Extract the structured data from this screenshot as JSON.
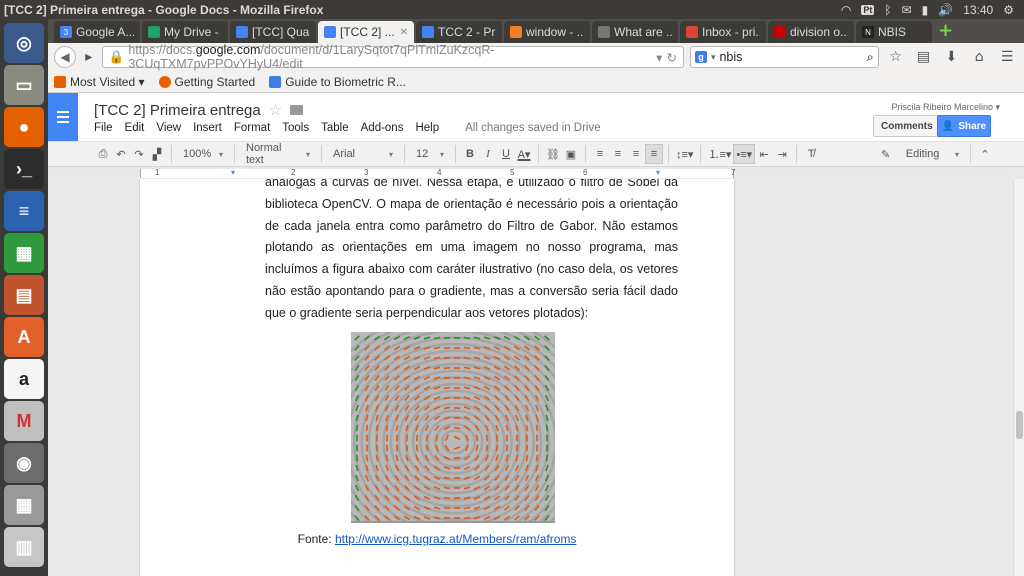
{
  "window": {
    "title": "[TCC 2] Primeira entrega - Google Docs - Mozilla Firefox",
    "tray_pt": "Pt",
    "clock": "13:40"
  },
  "tabs": [
    {
      "label": "Google A...",
      "color": "#4285f4",
      "glyph": "3"
    },
    {
      "label": "My Drive - ...",
      "color": "#1fa463",
      "glyph": ""
    },
    {
      "label": "[TCC] Qua...",
      "color": "#4285f4",
      "glyph": ""
    },
    {
      "label": "[TCC 2] ...",
      "color": "#4285f4",
      "glyph": ""
    },
    {
      "label": "TCC 2 - Pri...",
      "color": "#4285f4",
      "glyph": ""
    },
    {
      "label": "window - ...",
      "color": "#f48024",
      "glyph": ""
    },
    {
      "label": "What are ...",
      "color": "#777777",
      "glyph": ""
    },
    {
      "label": "Inbox - pri...",
      "color": "#db4437",
      "glyph": ""
    },
    {
      "label": "division o...",
      "color": "#cc0000",
      "glyph": ""
    },
    {
      "label": "NBIS",
      "color": "#222222",
      "glyph": "N"
    }
  ],
  "nav": {
    "url_prefix": "https://docs.",
    "url_host": "google.com",
    "url_rest": "/document/d/1LarySqtot7qPlTmiZuKzcqR-3CUqTXM7pvPPOvYHyU4/edit",
    "search_value": "nbis"
  },
  "bookmarks": [
    {
      "label": "Most Visited ▾",
      "color": "#e66000"
    },
    {
      "label": "Getting Started",
      "color": "#e66000"
    },
    {
      "label": "Guide to Biometric R...",
      "color": "#3d7de4"
    }
  ],
  "doc": {
    "title": "[TCC 2] Primeira entrega",
    "menus": [
      "File",
      "Edit",
      "View",
      "Insert",
      "Format",
      "Tools",
      "Table",
      "Add-ons",
      "Help"
    ],
    "saved_status": "All changes saved in Drive",
    "user": "Priscila Ribeiro Marcelino ▾",
    "comments_label": "Comments",
    "share_label": "Share"
  },
  "toolbar": {
    "zoom": "100%",
    "style": "Normal text",
    "font": "Arial",
    "size": "12",
    "mode": "Editing"
  },
  "ruler": [
    "1",
    "1",
    "2",
    "3",
    "4",
    "5",
    "6",
    "7"
  ],
  "body": {
    "paragraph": "análogas a curvas de nível. Nessa etapa, é utilizado o filtro de Sobel da biblioteca OpenCV. O mapa de orientação é necessário pois a orientação de cada janela entra como parâmetro do Filtro de Gabor. Não estamos plotando as orientações em uma imagem no nosso programa, mas incluímos a figura abaixo com caráter ilustrativo (no caso dela, os vetores não estão apontando para o gradiente, mas a conversão seria fácil dado que o gradiente seria perpendicular aos vetores plotados):",
    "caption_label": "Fonte: ",
    "caption_link": "http://www.icg.tugraz.at/Members/ram/afroms"
  }
}
